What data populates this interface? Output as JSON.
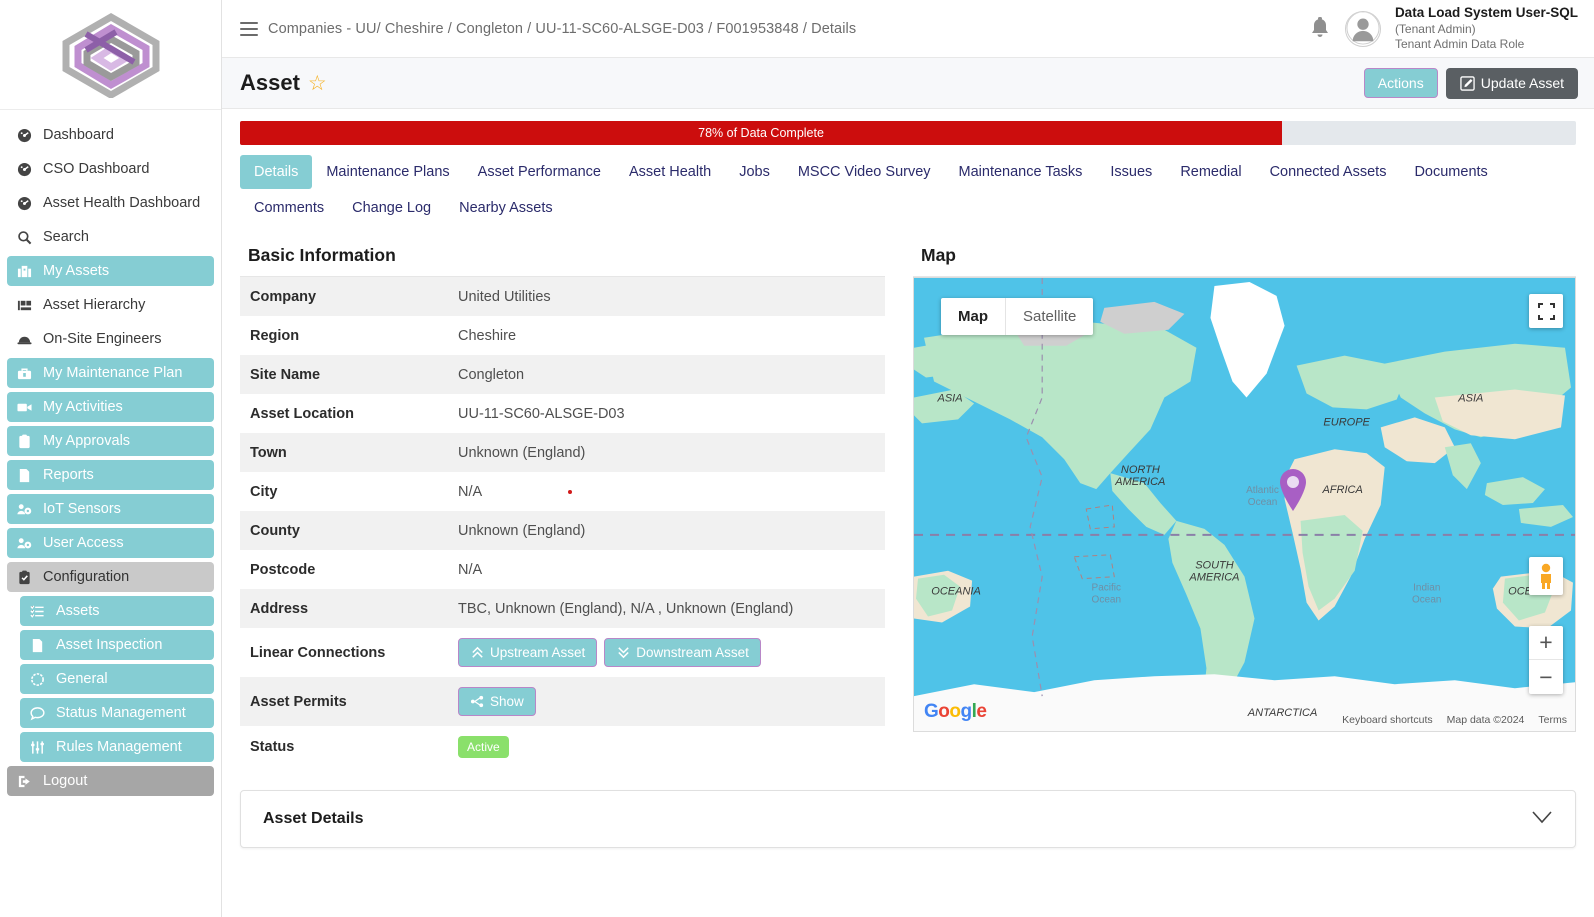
{
  "sidebar": {
    "logo_alt": "company-logo",
    "items": [
      {
        "label": "Dashboard",
        "icon": "gauge-icon",
        "style": "plain",
        "sub": false
      },
      {
        "label": "CSO Dashboard",
        "icon": "gauge-icon",
        "style": "plain",
        "sub": false
      },
      {
        "label": "Asset Health Dashboard",
        "icon": "gauge-icon",
        "style": "plain",
        "sub": false
      },
      {
        "label": "Search",
        "icon": "search-icon",
        "style": "plain",
        "sub": false
      },
      {
        "label": "My Assets",
        "icon": "building-icon",
        "style": "teal",
        "sub": false
      },
      {
        "label": "Asset Hierarchy",
        "icon": "hierarchy-icon",
        "style": "plain",
        "sub": false
      },
      {
        "label": "On-Site Engineers",
        "icon": "hardhat-icon",
        "style": "plain",
        "sub": false
      },
      {
        "label": "My Maintenance Plan",
        "icon": "toolbox-icon",
        "style": "teal",
        "sub": false
      },
      {
        "label": "My Activities",
        "icon": "activity-icon",
        "style": "teal",
        "sub": false
      },
      {
        "label": "My Approvals",
        "icon": "clipboard-check-icon",
        "style": "teal",
        "sub": false
      },
      {
        "label": "Reports",
        "icon": "document-icon",
        "style": "teal",
        "sub": false
      },
      {
        "label": "IoT Sensors",
        "icon": "users-cog-icon",
        "style": "teal",
        "sub": false
      },
      {
        "label": "User Access",
        "icon": "users-cog-icon",
        "style": "teal",
        "sub": false
      },
      {
        "label": "Configuration",
        "icon": "clipboard-check-icon",
        "style": "grey",
        "sub": false
      },
      {
        "label": "Assets",
        "icon": "list-icon",
        "style": "teal",
        "sub": true
      },
      {
        "label": "Asset Inspection",
        "icon": "document-icon",
        "style": "teal",
        "sub": true
      },
      {
        "label": "General",
        "icon": "circle-icon",
        "style": "teal",
        "sub": true
      },
      {
        "label": "Status Management",
        "icon": "comment-icon",
        "style": "teal",
        "sub": true
      },
      {
        "label": "Rules Management",
        "icon": "sliders-icon",
        "style": "teal",
        "sub": true
      },
      {
        "label": "Logout",
        "icon": "logout-icon",
        "style": "dark",
        "sub": false
      }
    ]
  },
  "topbar": {
    "menu_icon": "hamburger-icon",
    "breadcrumb": "Companies - UU/ Cheshire / Congleton / UU-11-SC60-ALSGE-D03 / F001953848 / Details",
    "bell_icon": "notification-bell-icon",
    "user": {
      "name": "Data Load System User-SQL",
      "role": "(Tenant Admin)",
      "data_role": "Tenant Admin Data Role"
    }
  },
  "page": {
    "title": "Asset",
    "favourite_icon": "star-icon",
    "actions_button": "Actions",
    "update_button": "Update Asset",
    "update_icon": "edit-pencil-icon"
  },
  "progress": {
    "label": "78% of Data Complete",
    "percent": 78,
    "fill_color": "#cc0d0d",
    "track_color": "#e4e8ec"
  },
  "tabs": [
    {
      "label": "Details",
      "active": true
    },
    {
      "label": "Maintenance Plans",
      "active": false
    },
    {
      "label": "Asset Performance",
      "active": false
    },
    {
      "label": "Asset Health",
      "active": false
    },
    {
      "label": "Jobs",
      "active": false
    },
    {
      "label": "MSCC Video Survey",
      "active": false
    },
    {
      "label": "Maintenance Tasks",
      "active": false
    },
    {
      "label": "Issues",
      "active": false
    },
    {
      "label": "Remedial",
      "active": false
    },
    {
      "label": "Connected Assets",
      "active": false
    },
    {
      "label": "Documents",
      "active": false
    },
    {
      "label": "Comments",
      "active": false
    },
    {
      "label": "Change Log",
      "active": false
    },
    {
      "label": "Nearby Assets",
      "active": false
    }
  ],
  "basic_information": {
    "heading": "Basic Information",
    "rows": [
      {
        "key": "Company",
        "value": "United Utilities"
      },
      {
        "key": "Region",
        "value": "Cheshire"
      },
      {
        "key": "Site Name",
        "value": "Congleton"
      },
      {
        "key": "Asset Location",
        "value": "UU-11-SC60-ALSGE-D03"
      },
      {
        "key": "Town",
        "value": "Unknown (England)"
      },
      {
        "key": "City",
        "value": "N/A"
      },
      {
        "key": "County",
        "value": "Unknown (England)"
      },
      {
        "key": "Postcode",
        "value": "N/A"
      },
      {
        "key": "Address",
        "value": "TBC, Unknown (England), N/A , Unknown (England)"
      },
      {
        "key": "Linear Connections",
        "value": ""
      },
      {
        "key": "Asset Permits",
        "value": ""
      },
      {
        "key": "Status",
        "value": "Active"
      }
    ],
    "upstream_button": "Upstream Asset",
    "downstream_button": "Downstream Asset",
    "show_button": "Show",
    "status_badge": "Active",
    "status_color": "#8ae06b"
  },
  "map": {
    "heading": "Map",
    "type_map": "Map",
    "type_satellite": "Satellite",
    "fullscreen_icon": "fullscreen-icon",
    "pegman_icon": "street-view-pegman-icon",
    "zoom_in": "+",
    "zoom_out": "−",
    "watermark": "Google",
    "footer_shortcuts": "Keyboard shortcuts",
    "footer_data": "Map data ©2024",
    "footer_terms": "Terms",
    "marker_color": "#a85fc4",
    "labels": {
      "north_america": "NORTH\nAMERICA",
      "south_america": "SOUTH\nAMERICA",
      "europe": "EUROPE",
      "africa": "AFRICA",
      "asia": "ASIA",
      "oceania": "OCEANIA",
      "antarctica": "ANTARCTICA",
      "atlantic": "Atlantic\nOcean",
      "pacific": "Pacific\nOcean",
      "indian": "Indian\nOcean"
    }
  },
  "asset_details_panel": {
    "title": "Asset Details",
    "chevron_icon": "chevron-down-icon",
    "expanded": false
  }
}
